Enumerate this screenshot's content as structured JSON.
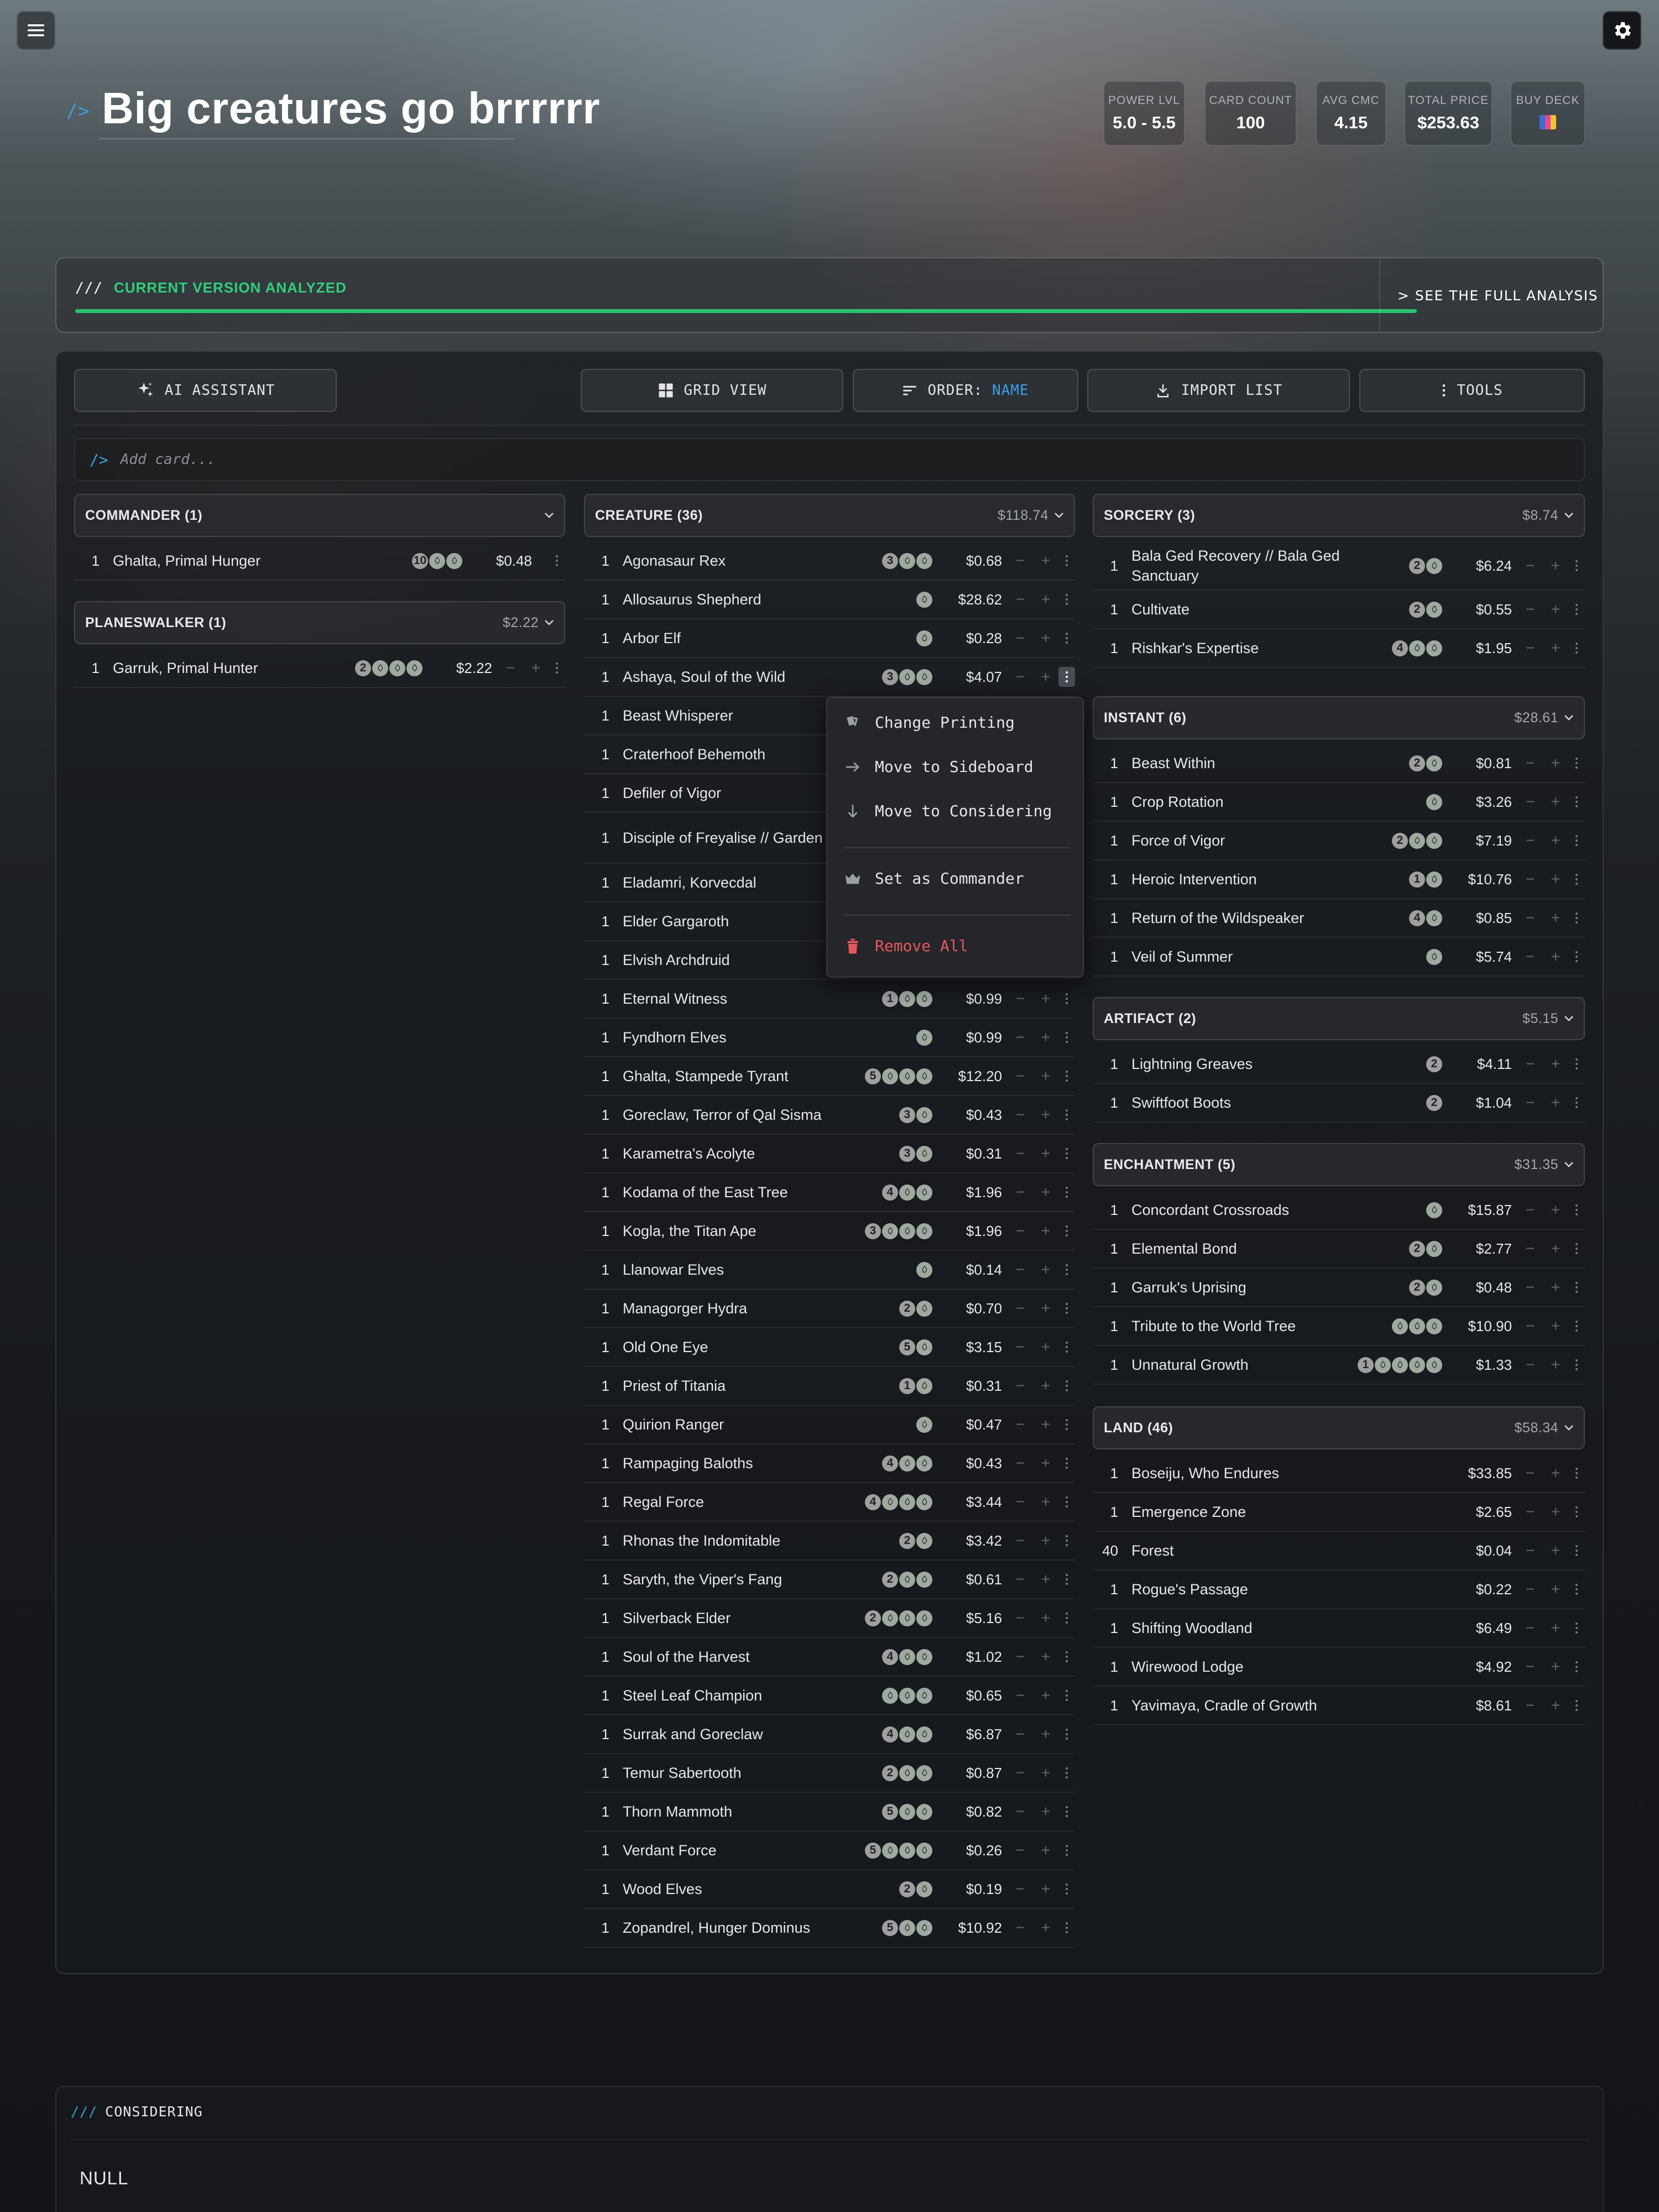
{
  "deck": {
    "title": "Big creatures go brrrrrr",
    "title_prefix": "/>",
    "stats": [
      {
        "label": "POWER LVL",
        "value": "5.0 - 5.5"
      },
      {
        "label": "CARD COUNT",
        "value": "100"
      },
      {
        "label": "AVG CMC",
        "value": "4.15"
      },
      {
        "label": "TOTAL PRICE",
        "value": "$253.63"
      },
      {
        "label": "BUY DECK",
        "value": ""
      }
    ]
  },
  "analysis": {
    "prefix": "///",
    "label": "CURRENT VERSION ANALYZED",
    "see_full": "> SEE THE FULL ANALYSIS",
    "progress_percent": 100,
    "bar_color": "#27c46d"
  },
  "toolbar": {
    "ai_assistant": "AI ASSISTANT",
    "grid_view": "GRID VIEW",
    "order_label": "ORDER:",
    "order_value": "NAME",
    "import_list": "IMPORT LIST",
    "tools": "TOOLS"
  },
  "add_card": {
    "prefix": "/>",
    "placeholder": "Add card..."
  },
  "groups": [
    {
      "title": "COMMANDER (1)",
      "price": "",
      "cards": [
        {
          "qty": "1",
          "name": "Ghalta, Primal Hunger",
          "mana": [
            "10",
            "G",
            "G"
          ],
          "price": "$0.48"
        }
      ]
    },
    {
      "title": "PLANESWALKER (1)",
      "price": "$2.22",
      "cards": [
        {
          "qty": "1",
          "name": "Garruk, Primal Hunter",
          "mana": [
            "2",
            "G",
            "G",
            "G"
          ],
          "price": "$2.22"
        }
      ]
    },
    {
      "title": "CREATURE (36)",
      "price": "$118.74",
      "cards": [
        {
          "qty": "1",
          "name": "Agonasaur Rex",
          "mana": [
            "3",
            "G",
            "G"
          ],
          "price": "$0.68"
        },
        {
          "qty": "1",
          "name": "Allosaurus Shepherd",
          "mana": [
            "G"
          ],
          "price": "$28.62"
        },
        {
          "qty": "1",
          "name": "Arbor Elf",
          "mana": [
            "G"
          ],
          "price": "$0.28"
        },
        {
          "qty": "1",
          "name": "Ashaya, Soul of the Wild",
          "mana": [
            "3",
            "G",
            "G"
          ],
          "price": "$4.07"
        },
        {
          "qty": "1",
          "name": "Beast Whisperer",
          "mana": [],
          "price": ""
        },
        {
          "qty": "1",
          "name": "Craterhoof Behemoth",
          "mana": [],
          "price": ""
        },
        {
          "qty": "1",
          "name": "Defiler of Vigor",
          "mana": [],
          "price": ""
        },
        {
          "qty": "1",
          "name": "Disciple of Freyalise // Garden of Freyalise",
          "mana": [],
          "price": ""
        },
        {
          "qty": "1",
          "name": "Eladamri, Korvecdal",
          "mana": [],
          "price": ""
        },
        {
          "qty": "1",
          "name": "Elder Gargaroth",
          "mana": [],
          "price": ""
        },
        {
          "qty": "1",
          "name": "Elvish Archdruid",
          "mana": [],
          "price": ""
        },
        {
          "qty": "1",
          "name": "Eternal Witness",
          "mana": [
            "1",
            "G",
            "G"
          ],
          "price": "$0.99"
        },
        {
          "qty": "1",
          "name": "Fyndhorn Elves",
          "mana": [
            "G"
          ],
          "price": "$0.99"
        },
        {
          "qty": "1",
          "name": "Ghalta, Stampede Tyrant",
          "mana": [
            "5",
            "G",
            "G",
            "G"
          ],
          "price": "$12.20"
        },
        {
          "qty": "1",
          "name": "Goreclaw, Terror of Qal Sisma",
          "mana": [
            "3",
            "G"
          ],
          "price": "$0.43"
        },
        {
          "qty": "1",
          "name": "Karametra's Acolyte",
          "mana": [
            "3",
            "G"
          ],
          "price": "$0.31"
        },
        {
          "qty": "1",
          "name": "Kodama of the East Tree",
          "mana": [
            "4",
            "G",
            "G"
          ],
          "price": "$1.96"
        },
        {
          "qty": "1",
          "name": "Kogla, the Titan Ape",
          "mana": [
            "3",
            "G",
            "G",
            "G"
          ],
          "price": "$1.96"
        },
        {
          "qty": "1",
          "name": "Llanowar Elves",
          "mana": [
            "G"
          ],
          "price": "$0.14"
        },
        {
          "qty": "1",
          "name": "Managorger Hydra",
          "mana": [
            "2",
            "G"
          ],
          "price": "$0.70"
        },
        {
          "qty": "1",
          "name": "Old One Eye",
          "mana": [
            "5",
            "G"
          ],
          "price": "$3.15"
        },
        {
          "qty": "1",
          "name": "Priest of Titania",
          "mana": [
            "1",
            "G"
          ],
          "price": "$0.31"
        },
        {
          "qty": "1",
          "name": "Quirion Ranger",
          "mana": [
            "G"
          ],
          "price": "$0.47"
        },
        {
          "qty": "1",
          "name": "Rampaging Baloths",
          "mana": [
            "4",
            "G",
            "G"
          ],
          "price": "$0.43"
        },
        {
          "qty": "1",
          "name": "Regal Force",
          "mana": [
            "4",
            "G",
            "G",
            "G"
          ],
          "price": "$3.44"
        },
        {
          "qty": "1",
          "name": "Rhonas the Indomitable",
          "mana": [
            "2",
            "G"
          ],
          "price": "$3.42"
        },
        {
          "qty": "1",
          "name": "Saryth, the Viper's Fang",
          "mana": [
            "2",
            "G",
            "G"
          ],
          "price": "$0.61"
        },
        {
          "qty": "1",
          "name": "Silverback Elder",
          "mana": [
            "2",
            "G",
            "G",
            "G"
          ],
          "price": "$5.16"
        },
        {
          "qty": "1",
          "name": "Soul of the Harvest",
          "mana": [
            "4",
            "G",
            "G"
          ],
          "price": "$1.02"
        },
        {
          "qty": "1",
          "name": "Steel Leaf Champion",
          "mana": [
            "G",
            "G",
            "G"
          ],
          "price": "$0.65"
        },
        {
          "qty": "1",
          "name": "Surrak and Goreclaw",
          "mana": [
            "4",
            "G",
            "G"
          ],
          "price": "$6.87"
        },
        {
          "qty": "1",
          "name": "Temur Sabertooth",
          "mana": [
            "2",
            "G",
            "G"
          ],
          "price": "$0.87"
        },
        {
          "qty": "1",
          "name": "Thorn Mammoth",
          "mana": [
            "5",
            "G",
            "G"
          ],
          "price": "$0.82"
        },
        {
          "qty": "1",
          "name": "Verdant Force",
          "mana": [
            "5",
            "G",
            "G",
            "G"
          ],
          "price": "$0.26"
        },
        {
          "qty": "1",
          "name": "Wood Elves",
          "mana": [
            "2",
            "G"
          ],
          "price": "$0.19"
        },
        {
          "qty": "1",
          "name": "Zopandrel, Hunger Dominus",
          "mana": [
            "5",
            "G",
            "G"
          ],
          "price": "$10.92"
        }
      ]
    },
    {
      "title": "SORCERY (3)",
      "price": "$8.74",
      "cards": [
        {
          "qty": "1",
          "name": "Bala Ged Recovery // Bala Ged Sanctuary",
          "mana": [
            "2",
            "G"
          ],
          "price": "$6.24"
        },
        {
          "qty": "1",
          "name": "Cultivate",
          "mana": [
            "2",
            "G"
          ],
          "price": "$0.55"
        },
        {
          "qty": "1",
          "name": "Rishkar's Expertise",
          "mana": [
            "4",
            "G",
            "G"
          ],
          "price": "$1.95"
        }
      ]
    },
    {
      "title": "INSTANT (6)",
      "price": "$28.61",
      "cards": [
        {
          "qty": "1",
          "name": "Beast Within",
          "mana": [
            "2",
            "G"
          ],
          "price": "$0.81"
        },
        {
          "qty": "1",
          "name": "Crop Rotation",
          "mana": [
            "G"
          ],
          "price": "$3.26"
        },
        {
          "qty": "1",
          "name": "Force of Vigor",
          "mana": [
            "2",
            "G",
            "G"
          ],
          "price": "$7.19"
        },
        {
          "qty": "1",
          "name": "Heroic Intervention",
          "mana": [
            "1",
            "G"
          ],
          "price": "$10.76"
        },
        {
          "qty": "1",
          "name": "Return of the Wildspeaker",
          "mana": [
            "4",
            "G"
          ],
          "price": "$0.85"
        },
        {
          "qty": "1",
          "name": "Veil of Summer",
          "mana": [
            "G"
          ],
          "price": "$5.74"
        }
      ]
    },
    {
      "title": "ARTIFACT (2)",
      "price": "$5.15",
      "cards": [
        {
          "qty": "1",
          "name": "Lightning Greaves",
          "mana": [
            "2"
          ],
          "price": "$4.11"
        },
        {
          "qty": "1",
          "name": "Swiftfoot Boots",
          "mana": [
            "2"
          ],
          "price": "$1.04"
        }
      ]
    },
    {
      "title": "ENCHANTMENT (5)",
      "price": "$31.35",
      "cards": [
        {
          "qty": "1",
          "name": "Concordant Crossroads",
          "mana": [
            "G"
          ],
          "price": "$15.87"
        },
        {
          "qty": "1",
          "name": "Elemental Bond",
          "mana": [
            "2",
            "G"
          ],
          "price": "$2.77"
        },
        {
          "qty": "1",
          "name": "Garruk's Uprising",
          "mana": [
            "2",
            "G"
          ],
          "price": "$0.48"
        },
        {
          "qty": "1",
          "name": "Tribute to the World Tree",
          "mana": [
            "G",
            "G",
            "G"
          ],
          "price": "$10.90"
        },
        {
          "qty": "1",
          "name": "Unnatural Growth",
          "mana": [
            "1",
            "G",
            "G",
            "G",
            "G"
          ],
          "price": "$1.33"
        }
      ]
    },
    {
      "title": "LAND (46)",
      "price": "$58.34",
      "cards": [
        {
          "qty": "1",
          "name": "Boseiju, Who Endures",
          "mana": [],
          "price": "$33.85"
        },
        {
          "qty": "1",
          "name": "Emergence Zone",
          "mana": [],
          "price": "$2.65"
        },
        {
          "qty": "40",
          "name": "Forest",
          "mana": [],
          "price": "$0.04"
        },
        {
          "qty": "1",
          "name": "Rogue's Passage",
          "mana": [],
          "price": "$0.22"
        },
        {
          "qty": "1",
          "name": "Shifting Woodland",
          "mana": [],
          "price": "$6.49"
        },
        {
          "qty": "1",
          "name": "Wirewood Lodge",
          "mana": [],
          "price": "$4.92"
        },
        {
          "qty": "1",
          "name": "Yavimaya, Cradle of Growth",
          "mana": [],
          "price": "$8.61"
        }
      ]
    }
  ],
  "context_menu": {
    "items": [
      {
        "label": "Change Printing",
        "icon": "cards-icon"
      },
      {
        "label": "Move to Sideboard",
        "icon": "arrow-right-icon"
      },
      {
        "label": "Move to Considering",
        "icon": "arrow-down-icon"
      },
      {
        "label": "Set as Commander",
        "icon": "crown-icon"
      },
      {
        "label": "Remove All",
        "icon": "trash-icon",
        "color": "#e8585a"
      }
    ]
  },
  "considering": {
    "prefix": "///",
    "label": "CONSIDERING",
    "content": "NULL"
  },
  "colors": {
    "accent": "#3a9fd8",
    "success": "#27c46d",
    "danger": "#e8585a"
  }
}
